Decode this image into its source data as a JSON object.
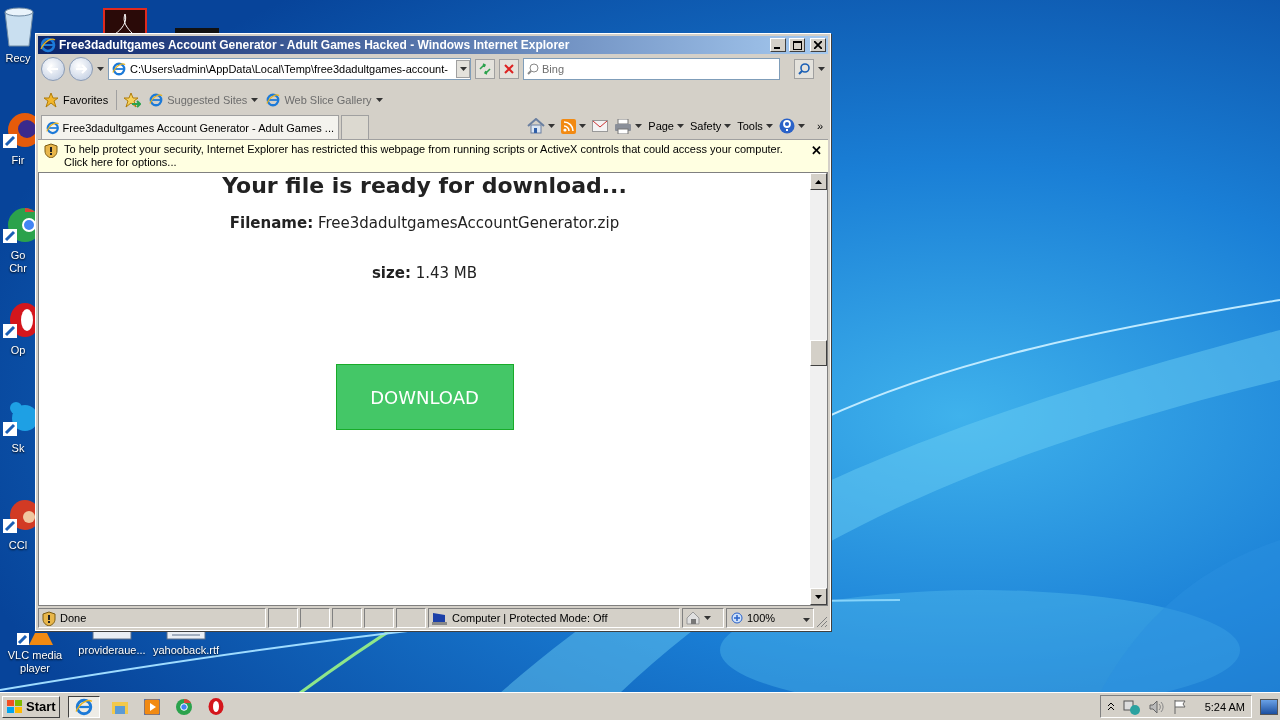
{
  "desktop_icons": [
    {
      "kind": "recycle-bin",
      "label": "Recy"
    },
    {
      "kind": "pdf"
    },
    {
      "kind": "dark-app"
    },
    {
      "kind": "firefox",
      "label": "Fir"
    },
    {
      "kind": "chrome",
      "label": "Go Chr"
    },
    {
      "kind": "opera",
      "label": "Op"
    },
    {
      "kind": "skype",
      "label": "Sk"
    },
    {
      "kind": "ccleaner",
      "label": "CCl"
    },
    {
      "kind": "vlc",
      "label": "VLC media player"
    },
    {
      "kind": "file",
      "label": "provideraue..."
    },
    {
      "kind": "document",
      "label": "yahooback.rtf"
    }
  ],
  "window": {
    "title": "Free3dadultgames Account Generator - Adult Games Hacked - Windows Internet Explorer",
    "address": "C:\\Users\\admin\\AppData\\Local\\Temp\\free3dadultgames-account-",
    "search": {
      "placeholder": "Bing"
    },
    "favorites_bar": [
      {
        "kind": "favorites",
        "label": "Favorites"
      },
      {
        "kind": "add"
      },
      {
        "kind": "site",
        "label": "Suggested Sites"
      },
      {
        "kind": "site",
        "label": "Web Slice Gallery"
      }
    ],
    "tabs": [
      {
        "label": "Free3dadultgames Account Generator - Adult Games ...",
        "selected": true
      },
      {
        "selected": false
      }
    ],
    "command_bar": [
      {
        "kind": "home",
        "menu": true
      },
      {
        "kind": "feed",
        "menu": true
      },
      {
        "kind": "mail",
        "menu": false
      },
      {
        "kind": "print",
        "menu": true
      },
      {
        "kind": "text",
        "label": "Page",
        "menu": true
      },
      {
        "kind": "text",
        "label": "Safety",
        "menu": true
      },
      {
        "kind": "text",
        "label": "Tools",
        "menu": true
      },
      {
        "kind": "help",
        "menu": true
      },
      {
        "kind": "text",
        "label": "»",
        "menu": false
      }
    ],
    "info_bar": "To help protect your security, Internet Explorer has restricted this webpage from running scripts or ActiveX controls that could access your computer. Click here for options...",
    "info_close": "✕",
    "page": {
      "heading": "Your file is ready for download...",
      "filename": "**Filename:** Free3dadultgamesAccountGenerator.zip",
      "size": "**size:** 1.43 MB",
      "button": "DOWNLOAD"
    },
    "status_bar": {
      "status": "Done",
      "zone": "Computer | Protected Mode: Off",
      "zoom": "100%"
    }
  },
  "taskbar": {
    "start": "Start",
    "apps": [
      {
        "kind": "ie",
        "selected": true
      },
      {
        "kind": "explorer",
        "selected": false
      },
      {
        "kind": "media",
        "selected": false
      },
      {
        "kind": "chrome",
        "selected": false
      },
      {
        "kind": "opera",
        "selected": false
      }
    ],
    "time": "5:24 AM"
  }
}
